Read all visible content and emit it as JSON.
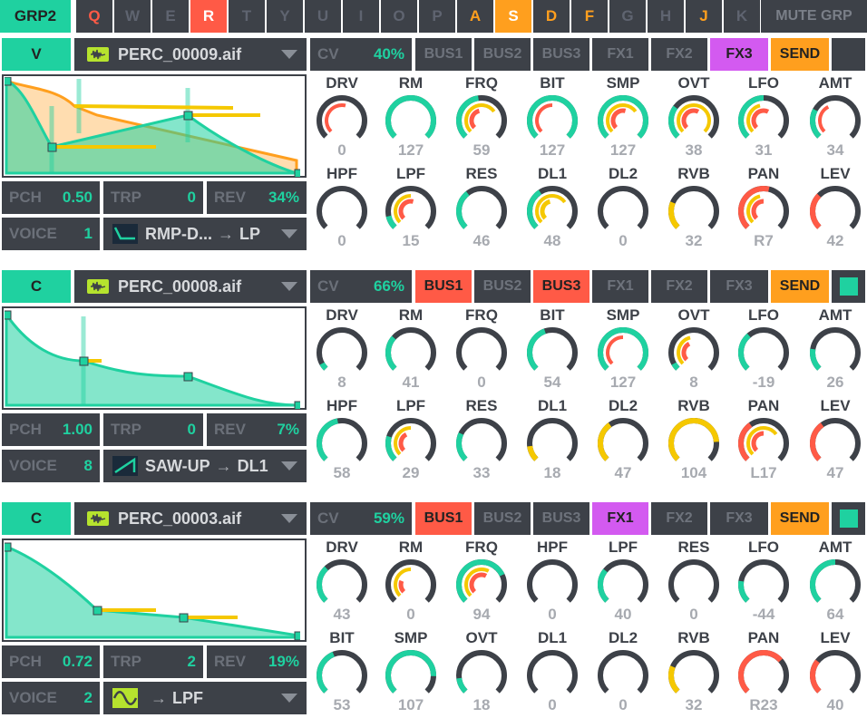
{
  "top_bar": {
    "group": "GRP2",
    "keys": [
      {
        "label": "Q",
        "state": "red"
      },
      {
        "label": "W",
        "state": "off"
      },
      {
        "label": "E",
        "state": "off"
      },
      {
        "label": "R",
        "state": "sel-red"
      },
      {
        "label": "T",
        "state": "off"
      },
      {
        "label": "Y",
        "state": "off"
      },
      {
        "label": "U",
        "state": "off"
      },
      {
        "label": "I",
        "state": "off"
      },
      {
        "label": "O",
        "state": "off"
      },
      {
        "label": "P",
        "state": "off"
      },
      {
        "label": "A",
        "state": "orange"
      },
      {
        "label": "S",
        "state": "sel-orange"
      },
      {
        "label": "D",
        "state": "orange"
      },
      {
        "label": "F",
        "state": "orange"
      },
      {
        "label": "G",
        "state": "off"
      },
      {
        "label": "H",
        "state": "off"
      },
      {
        "label": "J",
        "state": "orange"
      },
      {
        "label": "K",
        "state": "off"
      }
    ],
    "mute": "MUTE GRP"
  },
  "colors": {
    "teal": "#1fd1a0",
    "red": "#ff5a46",
    "orange": "#ff9f1e",
    "yellow": "#f5c800",
    "purple": "#d35af0",
    "dark": "#3d4148"
  },
  "voices": [
    {
      "mode": "V",
      "file": "PERC_00009.aif",
      "cv_label": "CV",
      "cv": "40%",
      "buses": [
        {
          "label": "BUS1",
          "state": "off"
        },
        {
          "label": "BUS2",
          "state": "off"
        },
        {
          "label": "BUS3",
          "state": "off"
        },
        {
          "label": "FX1",
          "state": "off"
        },
        {
          "label": "FX2",
          "state": "off"
        },
        {
          "label": "FX3",
          "state": "on-purple"
        },
        {
          "label": "SEND",
          "state": "send"
        }
      ],
      "pch_label": "PCH",
      "pch": "0.50",
      "trp_label": "TRP",
      "trp": "0",
      "rev_label": "REV",
      "rev": "34%",
      "voice_label": "VOICE",
      "voice": "1",
      "route": "RMP-D...",
      "route_arrow": "→",
      "route_target": "LP",
      "route_icon": "ramp-down-icon",
      "knobs": [
        {
          "label": "DRV",
          "value": "0",
          "base": 0.0,
          "inner": [
            {
              "c": "red",
              "f": 0.55
            }
          ]
        },
        {
          "label": "RM",
          "value": "127",
          "base": 1.0,
          "inner": []
        },
        {
          "label": "FRQ",
          "value": "59",
          "base": 0.47,
          "inner": [
            {
              "c": "yellow",
              "f": 0.7
            },
            {
              "c": "red",
              "f": 0.45
            }
          ]
        },
        {
          "label": "BIT",
          "value": "127",
          "base": 1.0,
          "inner": [
            {
              "c": "red",
              "f": 0.5
            }
          ]
        },
        {
          "label": "SMP",
          "value": "127",
          "base": 1.0,
          "inner": [
            {
              "c": "yellow",
              "f": 0.7
            },
            {
              "c": "red",
              "f": 0.55
            }
          ]
        },
        {
          "label": "OVT",
          "value": "38",
          "base": 0.3,
          "inner": [
            {
              "c": "yellow",
              "f": 1.0
            },
            {
              "c": "red",
              "f": 0.6
            }
          ]
        },
        {
          "label": "LFO",
          "value": "31",
          "base": 0.5,
          "inner": [
            {
              "c": "yellow",
              "f": 0.45
            },
            {
              "c": "red",
              "f": 0.6
            }
          ]
        },
        {
          "label": "AMT",
          "value": "34",
          "base": 0.27,
          "inner": [
            {
              "c": "red",
              "f": 0.4
            }
          ]
        },
        {
          "label": "HPF",
          "value": "0",
          "base": 0.0,
          "inner": []
        },
        {
          "label": "LPF",
          "value": "15",
          "base": 0.12,
          "inner": [
            {
              "c": "yellow",
              "f": 0.5
            },
            {
              "c": "red",
              "f": 0.55
            }
          ]
        },
        {
          "label": "RES",
          "value": "46",
          "base": 0.36,
          "inner": []
        },
        {
          "label": "DL1",
          "value": "48",
          "base": 0.38,
          "inner": [
            {
              "c": "yellow",
              "f": 0.7
            },
            {
              "c": "yellow",
              "f": 0.45
            }
          ]
        },
        {
          "label": "DL2",
          "value": "0",
          "base": 0.0,
          "inner": []
        },
        {
          "label": "RVB",
          "value": "32",
          "base": 0.25,
          "color": "yellow",
          "inner": []
        },
        {
          "label": "PAN",
          "value": "R7",
          "base": 0.55,
          "color": "red",
          "inner": [
            {
              "c": "yellow",
              "f": 0.45
            },
            {
              "c": "red",
              "f": 0.5
            }
          ]
        },
        {
          "label": "LEV",
          "value": "42",
          "base": 0.33,
          "color": "red",
          "inner": []
        }
      ]
    },
    {
      "mode": "C",
      "file": "PERC_00008.aif",
      "cv_label": "CV",
      "cv": "66%",
      "buses": [
        {
          "label": "BUS1",
          "state": "on-red"
        },
        {
          "label": "BUS2",
          "state": "off"
        },
        {
          "label": "BUS3",
          "state": "on-red"
        },
        {
          "label": "FX1",
          "state": "off"
        },
        {
          "label": "FX2",
          "state": "off"
        },
        {
          "label": "FX3",
          "state": "off"
        },
        {
          "label": "SEND",
          "state": "send"
        }
      ],
      "pch_label": "PCH",
      "pch": "1.00",
      "trp_label": "TRP",
      "trp": "0",
      "rev_label": "REV",
      "rev": "7%",
      "voice_label": "VOICE",
      "voice": "8",
      "route": "SAW-UP",
      "route_arrow": "→",
      "route_target": "DL1",
      "route_icon": "saw-up-icon",
      "knobs": [
        {
          "label": "DRV",
          "value": "8",
          "base": 0.06,
          "inner": []
        },
        {
          "label": "RM",
          "value": "41",
          "base": 0.32,
          "inner": []
        },
        {
          "label": "FRQ",
          "value": "0",
          "base": 0.0,
          "inner": []
        },
        {
          "label": "BIT",
          "value": "54",
          "base": 0.43,
          "inner": []
        },
        {
          "label": "SMP",
          "value": "127",
          "base": 1.0,
          "inner": [
            {
              "c": "red",
              "f": 0.5
            }
          ]
        },
        {
          "label": "OVT",
          "value": "8",
          "base": 0.06,
          "inner": [
            {
              "c": "yellow",
              "f": 0.45
            },
            {
              "c": "red",
              "f": 0.4
            }
          ]
        },
        {
          "label": "LFO",
          "value": "-19",
          "base": 0.35,
          "inner": []
        },
        {
          "label": "AMT",
          "value": "26",
          "base": 0.2,
          "inner": []
        },
        {
          "label": "HPF",
          "value": "58",
          "base": 0.46,
          "inner": []
        },
        {
          "label": "LPF",
          "value": "29",
          "base": 0.23,
          "inner": [
            {
              "c": "yellow",
              "f": 0.5
            },
            {
              "c": "red",
              "f": 0.4
            }
          ]
        },
        {
          "label": "RES",
          "value": "33",
          "base": 0.26,
          "inner": []
        },
        {
          "label": "DL1",
          "value": "18",
          "base": 0.14,
          "color": "yellow",
          "inner": []
        },
        {
          "label": "DL2",
          "value": "47",
          "base": 0.37,
          "color": "yellow",
          "inner": []
        },
        {
          "label": "RVB",
          "value": "104",
          "base": 0.82,
          "color": "yellow",
          "inner": []
        },
        {
          "label": "PAN",
          "value": "L17",
          "base": 0.37,
          "color": "red",
          "inner": [
            {
              "c": "yellow",
              "f": 0.7
            },
            {
              "c": "red",
              "f": 0.5
            }
          ]
        },
        {
          "label": "LEV",
          "value": "47",
          "base": 0.37,
          "color": "red",
          "inner": []
        }
      ]
    },
    {
      "mode": "C",
      "file": "PERC_00003.aif",
      "cv_label": "CV",
      "cv": "59%",
      "buses": [
        {
          "label": "BUS1",
          "state": "on-red"
        },
        {
          "label": "BUS2",
          "state": "off"
        },
        {
          "label": "BUS3",
          "state": "off"
        },
        {
          "label": "FX1",
          "state": "on-purple"
        },
        {
          "label": "FX2",
          "state": "off"
        },
        {
          "label": "FX3",
          "state": "off"
        },
        {
          "label": "SEND",
          "state": "send"
        }
      ],
      "pch_label": "PCH",
      "pch": "0.72",
      "trp_label": "TRP",
      "trp": "2",
      "rev_label": "REV",
      "rev": "19%",
      "voice_label": "VOICE",
      "voice": "2",
      "route": "",
      "route_arrow": "→",
      "route_target": "LPF",
      "route_icon": "sine-icon",
      "knobs": [
        {
          "label": "DRV",
          "value": "43",
          "base": 0.34,
          "inner": []
        },
        {
          "label": "RM",
          "value": "0",
          "base": 0.0,
          "inner": [
            {
              "c": "yellow",
              "f": 0.5
            },
            {
              "c": "red",
              "f": 0.25
            }
          ]
        },
        {
          "label": "FRQ",
          "value": "94",
          "base": 0.74,
          "inner": [
            {
              "c": "yellow",
              "f": 0.6
            },
            {
              "c": "red",
              "f": 0.6
            }
          ]
        },
        {
          "label": "HPF",
          "value": "0",
          "base": 0.0,
          "inner": []
        },
        {
          "label": "LPF",
          "value": "40",
          "base": 0.31,
          "inner": []
        },
        {
          "label": "RES",
          "value": "0",
          "base": 0.0,
          "inner": []
        },
        {
          "label": "LFO",
          "value": "-44",
          "base": 0.2,
          "inner": []
        },
        {
          "label": "AMT",
          "value": "64",
          "base": 0.5,
          "inner": []
        },
        {
          "label": "BIT",
          "value": "53",
          "base": 0.42,
          "inner": []
        },
        {
          "label": "SMP",
          "value": "107",
          "base": 0.84,
          "inner": []
        },
        {
          "label": "OVT",
          "value": "18",
          "base": 0.14,
          "inner": []
        },
        {
          "label": "DL1",
          "value": "0",
          "base": 0.0,
          "inner": []
        },
        {
          "label": "DL2",
          "value": "0",
          "base": 0.0,
          "inner": []
        },
        {
          "label": "RVB",
          "value": "32",
          "base": 0.25,
          "color": "yellow",
          "inner": []
        },
        {
          "label": "PAN",
          "value": "R23",
          "base": 0.68,
          "color": "red",
          "inner": []
        },
        {
          "label": "LEV",
          "value": "40",
          "base": 0.31,
          "color": "red",
          "inner": []
        }
      ]
    }
  ]
}
